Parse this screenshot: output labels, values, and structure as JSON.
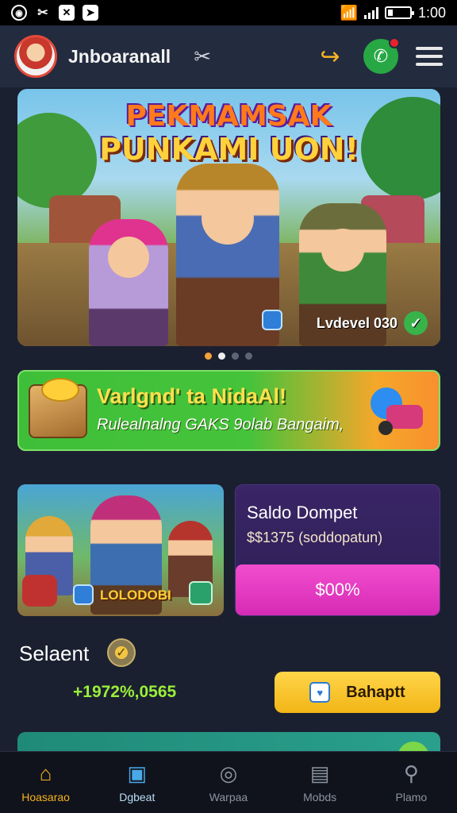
{
  "status_bar": {
    "time": "1:00",
    "icons": [
      "settings-ring-icon",
      "tools-icon",
      "x-icon",
      "send-icon",
      "wifi-icon",
      "signal-icon",
      "battery-icon"
    ]
  },
  "app_bar": {
    "title": "Jnboaranall",
    "icons": [
      "avatar",
      "tools-icon",
      "share-icon",
      "phone-icon",
      "menu-icon"
    ]
  },
  "hero": {
    "title_line1": "PEKMAMSAK",
    "title_line2": "PUNKAMI UON!",
    "badge_text": "Lvdevel 030",
    "carousel_count": 4,
    "carousel_active": 1
  },
  "promo": {
    "title": "Varlgnd' ta NidaAl!",
    "subtitle": "Rulealnalng GAKS 9olab Bangaim,"
  },
  "game_card": {
    "label": "LOLODOBI"
  },
  "wallet": {
    "title": "Saldo Dompet",
    "balance": "$$1375 (soddopatun)",
    "button_label": "$00%"
  },
  "select": {
    "label": "Selaent",
    "value": "+1972%,0565",
    "button_label": "Bahaptt"
  },
  "bottom_nav": {
    "items": [
      {
        "label": "Hoasarao",
        "icon": "home-icon"
      },
      {
        "label": "Dgbeat",
        "icon": "chat-icon"
      },
      {
        "label": "Warpaa",
        "icon": "globe-icon"
      },
      {
        "label": "Mobds",
        "icon": "bag-icon"
      },
      {
        "label": "Plamo",
        "icon": "search-icon"
      }
    ]
  },
  "colors": {
    "accent": "#f7b21b",
    "promo_green": "#45c33a",
    "wallet_purple": "#2c1f55",
    "wallet_button": "#e23bc3",
    "select_button": "#ffcc2e",
    "positive": "#9aee3a"
  }
}
